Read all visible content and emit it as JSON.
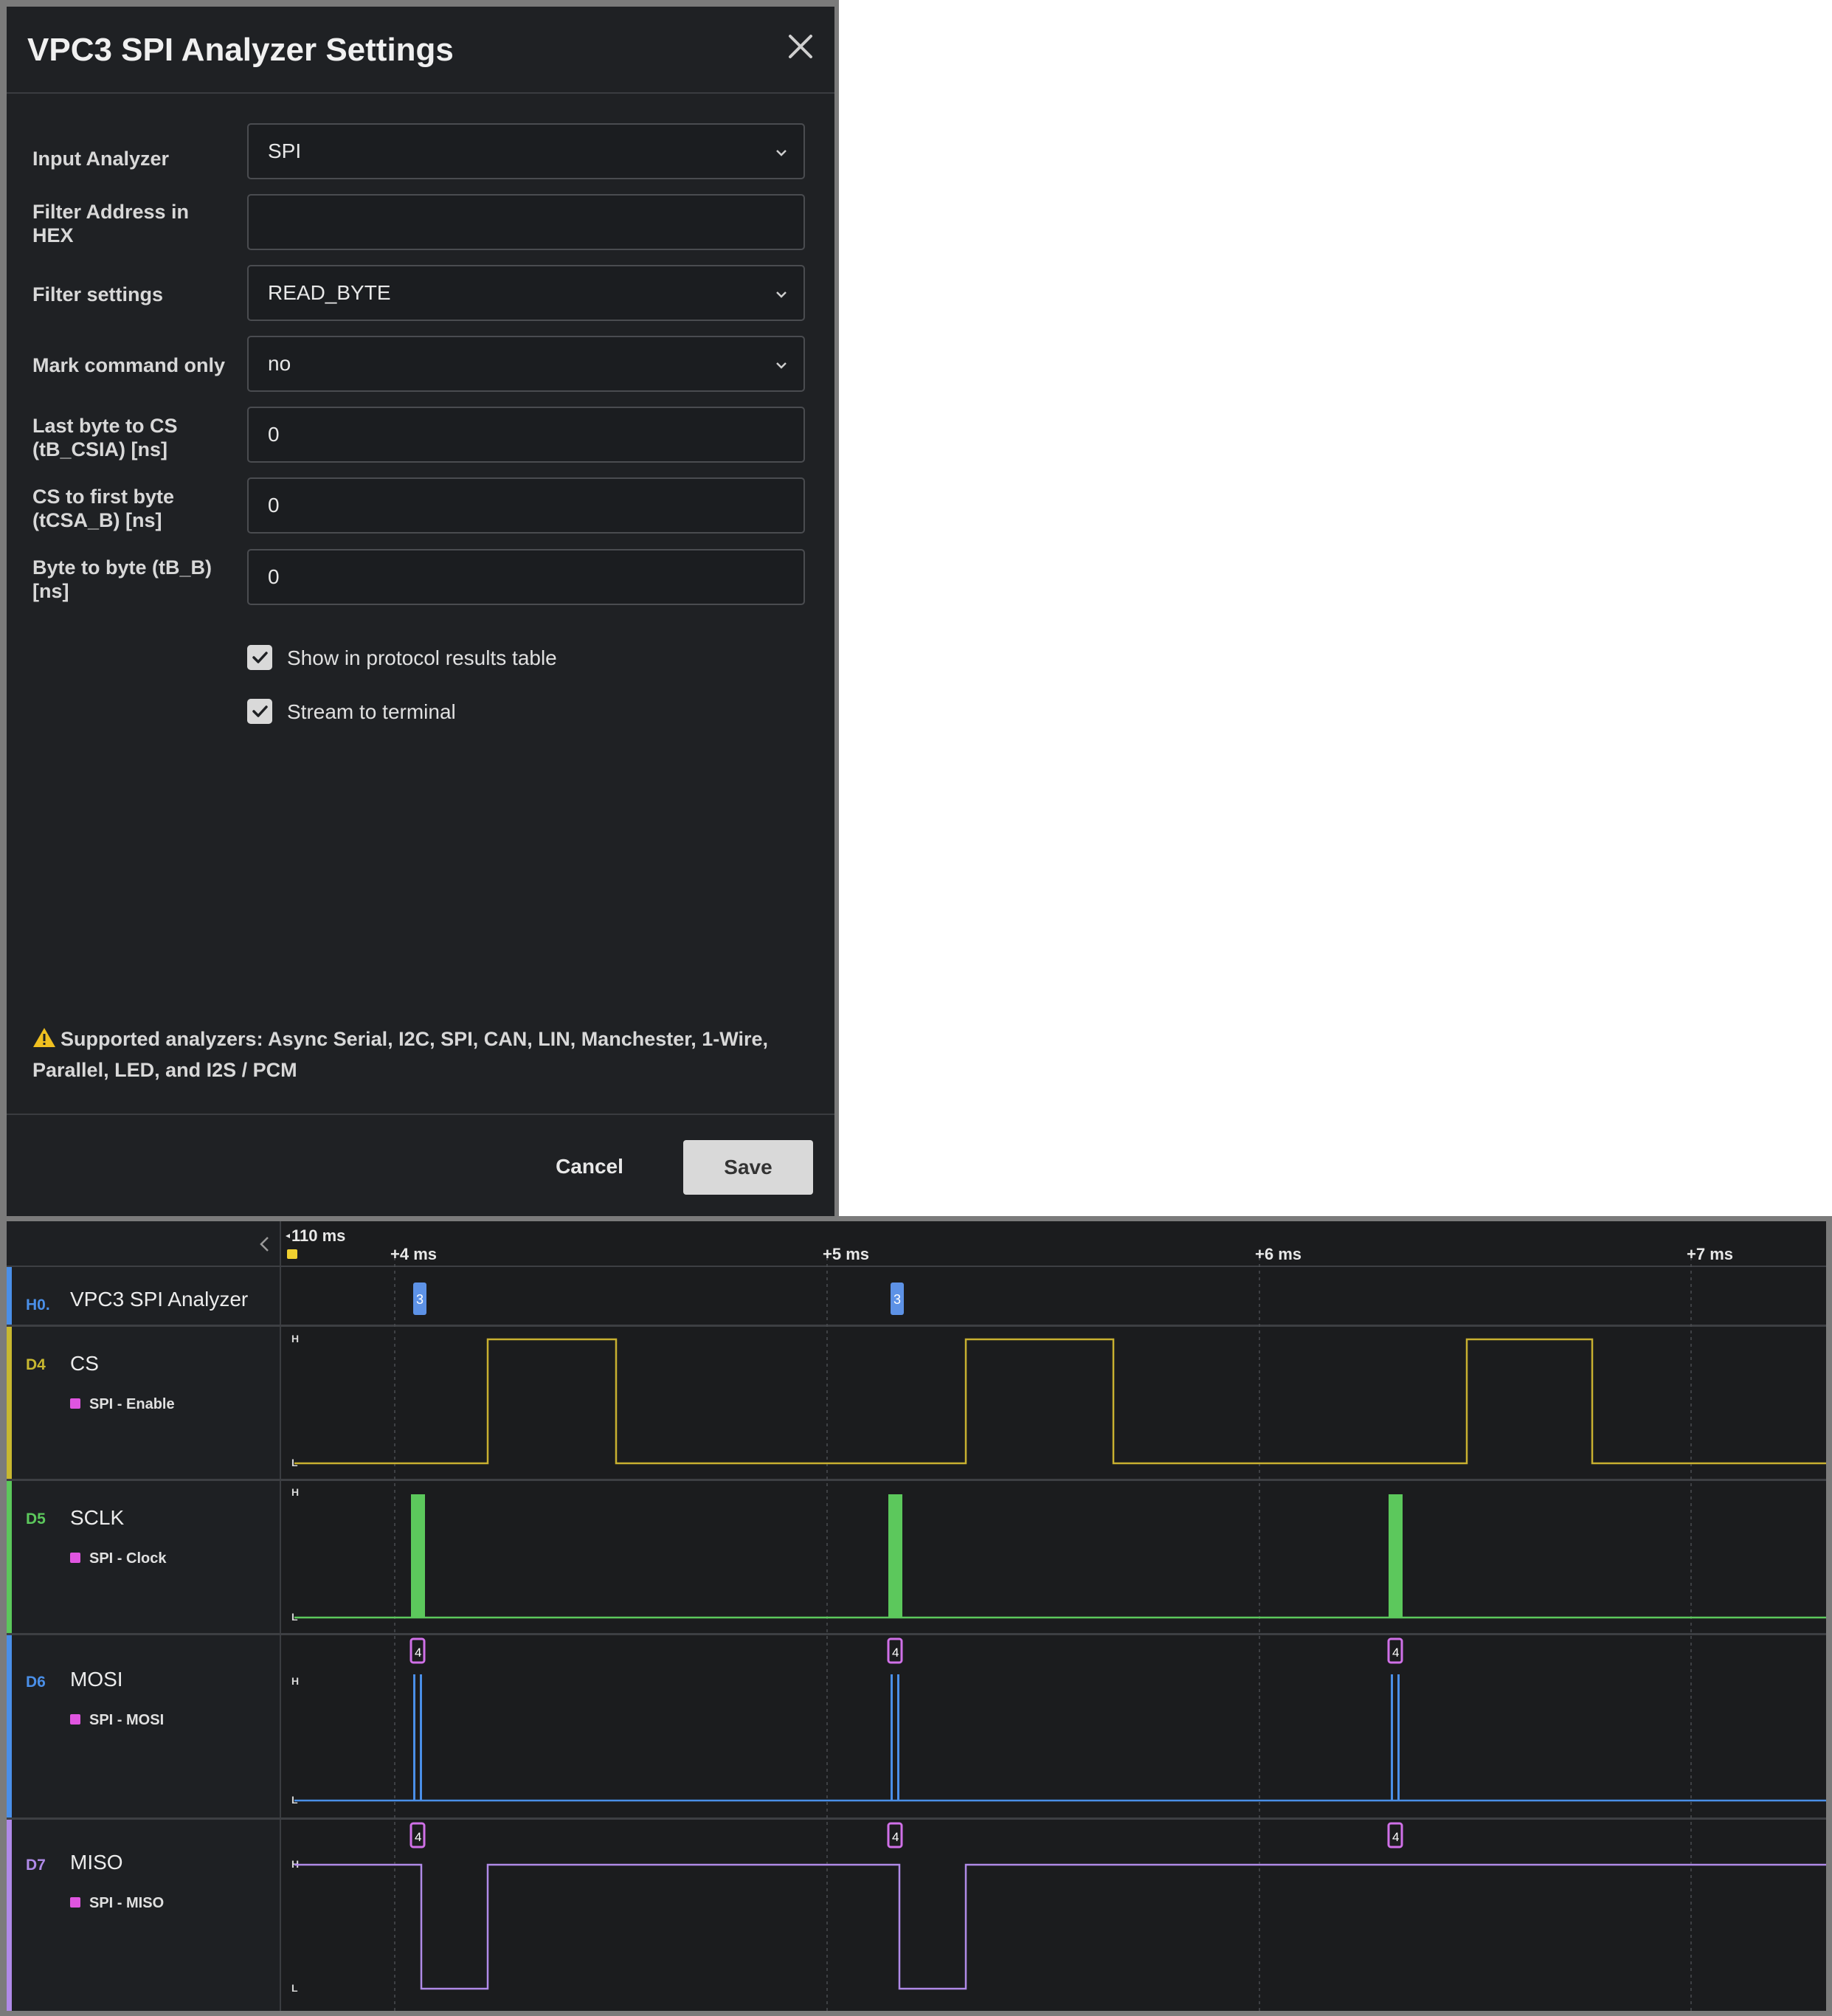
{
  "dialog": {
    "title": "VPC3 SPI Analyzer Settings",
    "fields": [
      {
        "label": "Input Analyzer",
        "value": "SPI",
        "type": "select"
      },
      {
        "label": "Filter Address in HEX",
        "value": "",
        "type": "text"
      },
      {
        "label": "Filter settings",
        "value": "READ_BYTE",
        "type": "select"
      },
      {
        "label": "Mark command only",
        "value": "no",
        "type": "select"
      },
      {
        "label": "Last byte to CS (tB_CSIA) [ns]",
        "value": "0",
        "type": "text"
      },
      {
        "label": "CS to first byte (tCSA_B) [ns]",
        "value": "0",
        "type": "text"
      },
      {
        "label": "Byte to byte (tB_B) [ns]",
        "value": "0",
        "type": "text"
      }
    ],
    "checkboxes": [
      {
        "label": "Show in protocol results table",
        "checked": true
      },
      {
        "label": "Stream to terminal",
        "checked": true
      }
    ],
    "warning": "Supported analyzers: Async Serial, I2C, SPI, CAN, LIN, Manchester, 1-Wire, Parallel, LED, and I2S / PCM",
    "cancel_label": "Cancel",
    "save_label": "Save"
  },
  "timeline": {
    "origin_label": "110 ms",
    "ticks": [
      "+4 ms",
      "+5 ms",
      "+6 ms",
      "+7 ms"
    ]
  },
  "channels": [
    {
      "code": "H0.",
      "name": "VPC3 SPI Analyzer",
      "sub": "",
      "color": "#4a8fe8"
    },
    {
      "code": "D4",
      "name": "CS",
      "sub": "SPI - Enable",
      "color": "#c8b830"
    },
    {
      "code": "D5",
      "name": "SCLK",
      "sub": "SPI - Clock",
      "color": "#5cc85c"
    },
    {
      "code": "D6",
      "name": "MOSI",
      "sub": "SPI - MOSI",
      "color": "#4a8fe8"
    },
    {
      "code": "D7",
      "name": "MISO",
      "sub": "SPI - MISO",
      "color": "#b08ae8"
    }
  ],
  "markers": {
    "analyzer": [
      "3",
      "3"
    ],
    "mosi": [
      "4",
      "4",
      "4"
    ],
    "miso": [
      "4",
      "4",
      "4"
    ]
  },
  "level_labels": {
    "high": "H",
    "low": "L"
  },
  "colors": {
    "cs": "#c8b030",
    "sclk": "#5cc85c",
    "mosi": "#4a8fe8",
    "miso": "#b08ae8",
    "analyzer_marker": "#5d92e6",
    "data_marker": "#d070e8"
  }
}
